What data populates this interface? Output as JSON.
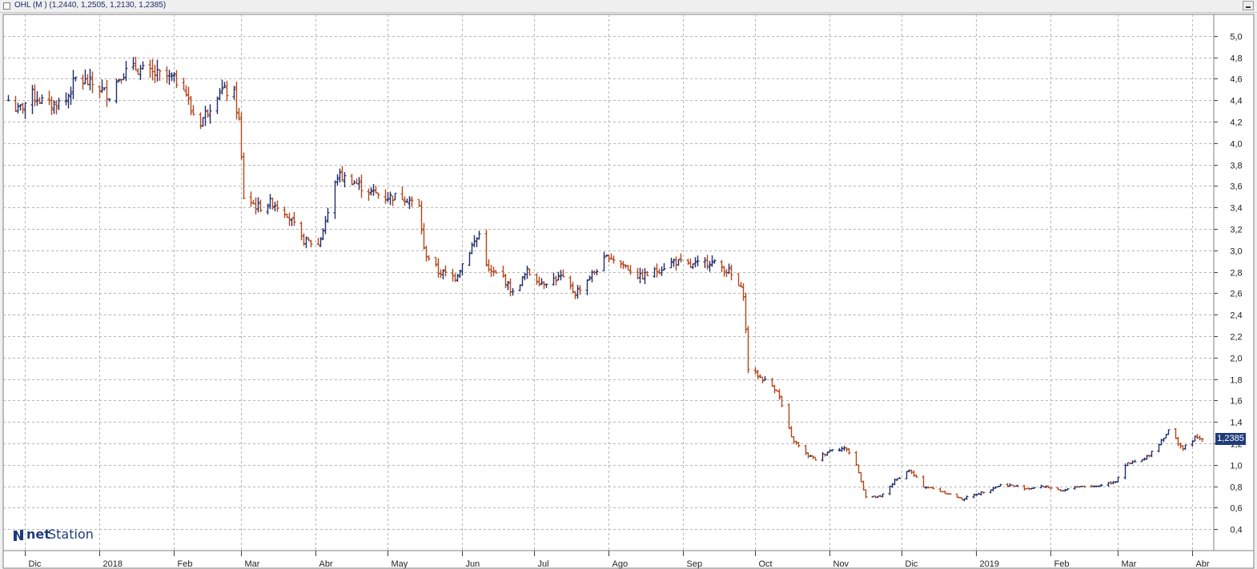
{
  "window": {
    "title": "OHL (M ) (1,2440, 1,2505, 1,2130, 1,2385)"
  },
  "logo": {
    "net": "net",
    "station": "Station"
  },
  "last_price_label": "1,2385",
  "colors": {
    "up": "#1f2d6b",
    "down": "#b4461a",
    "grid": "#b5b5b5",
    "last_tag": "#1f3b7a"
  },
  "chart_data": {
    "type": "ohlc",
    "title": "OHL (M ) (1,2440, 1,2505, 1,2130, 1,2385)",
    "last": {
      "open": 1.244,
      "high": 1.2505,
      "low": 1.213,
      "close": 1.2385
    },
    "ylim": [
      0.2,
      5.2
    ],
    "y_ticks": [
      0.4,
      0.6,
      0.8,
      1.0,
      1.2,
      1.4,
      1.6,
      1.8,
      2.0,
      2.2,
      2.4,
      2.6,
      2.8,
      3.0,
      3.2,
      3.4,
      3.6,
      3.8,
      4.0,
      4.2,
      4.4,
      4.6,
      4.8,
      5.0
    ],
    "y_tick_labels": [
      "0,4",
      "0,6",
      "0,8",
      "1,0",
      "1,2",
      "1,4",
      "1,6",
      "1,8",
      "2,0",
      "2,2",
      "2,4",
      "2,6",
      "2,8",
      "3,0",
      "3,2",
      "3,4",
      "3,6",
      "3,8",
      "4,0",
      "4,2",
      "4,4",
      "4,6",
      "4,8",
      "5,0"
    ],
    "x_months": [
      {
        "label": "Dic",
        "at": "2017-12-01"
      },
      {
        "label": "2018",
        "at": "2018-01-01"
      },
      {
        "label": "Feb",
        "at": "2018-02-01"
      },
      {
        "label": "Mar",
        "at": "2018-03-01"
      },
      {
        "label": "Abr",
        "at": "2018-04-01"
      },
      {
        "label": "May",
        "at": "2018-05-01"
      },
      {
        "label": "Jun",
        "at": "2018-06-01"
      },
      {
        "label": "Jul",
        "at": "2018-07-01"
      },
      {
        "label": "Ago",
        "at": "2018-08-01"
      },
      {
        "label": "Sep",
        "at": "2018-09-01"
      },
      {
        "label": "Oct",
        "at": "2018-10-01"
      },
      {
        "label": "Nov",
        "at": "2018-11-01"
      },
      {
        "label": "Dic",
        "at": "2018-12-01"
      },
      {
        "label": "2019",
        "at": "2019-01-01"
      },
      {
        "label": "Feb",
        "at": "2019-02-01"
      },
      {
        "label": "Mar",
        "at": "2019-03-01"
      },
      {
        "label": "Abr",
        "at": "2019-04-01"
      }
    ],
    "close_path": [
      [
        "2017-11-24",
        4.4
      ],
      [
        "2017-11-28",
        4.3
      ],
      [
        "2017-12-04",
        4.45
      ],
      [
        "2017-12-11",
        4.35
      ],
      [
        "2017-12-18",
        4.4
      ],
      [
        "2017-12-22",
        4.6
      ],
      [
        "2017-12-29",
        4.55
      ],
      [
        "2018-01-05",
        4.45
      ],
      [
        "2018-01-10",
        4.65
      ],
      [
        "2018-01-16",
        4.7
      ],
      [
        "2018-01-22",
        4.65
      ],
      [
        "2018-01-29",
        4.62
      ],
      [
        "2018-02-05",
        4.55
      ],
      [
        "2018-02-08",
        4.3
      ],
      [
        "2018-02-12",
        4.2
      ],
      [
        "2018-02-16",
        4.35
      ],
      [
        "2018-02-20",
        4.5
      ],
      [
        "2018-02-26",
        4.45
      ],
      [
        "2018-02-28",
        4.2
      ],
      [
        "2018-03-02",
        3.5
      ],
      [
        "2018-03-08",
        3.4
      ],
      [
        "2018-03-14",
        3.45
      ],
      [
        "2018-03-20",
        3.35
      ],
      [
        "2018-03-26",
        3.1
      ],
      [
        "2018-04-02",
        3.05
      ],
      [
        "2018-04-06",
        3.35
      ],
      [
        "2018-04-10",
        3.7
      ],
      [
        "2018-04-16",
        3.65
      ],
      [
        "2018-04-23",
        3.55
      ],
      [
        "2018-04-30",
        3.5
      ],
      [
        "2018-05-08",
        3.5
      ],
      [
        "2018-05-14",
        3.4
      ],
      [
        "2018-05-16",
        3.0
      ],
      [
        "2018-05-22",
        2.8
      ],
      [
        "2018-05-29",
        2.75
      ],
      [
        "2018-06-04",
        3.0
      ],
      [
        "2018-06-08",
        3.15
      ],
      [
        "2018-06-12",
        2.8
      ],
      [
        "2018-06-18",
        2.75
      ],
      [
        "2018-06-22",
        2.6
      ],
      [
        "2018-06-28",
        2.8
      ],
      [
        "2018-07-04",
        2.7
      ],
      [
        "2018-07-12",
        2.75
      ],
      [
        "2018-07-18",
        2.6
      ],
      [
        "2018-07-26",
        2.8
      ],
      [
        "2018-08-01",
        2.95
      ],
      [
        "2018-08-08",
        2.85
      ],
      [
        "2018-08-14",
        2.75
      ],
      [
        "2018-08-20",
        2.8
      ],
      [
        "2018-08-28",
        2.9
      ],
      [
        "2018-09-04",
        2.85
      ],
      [
        "2018-09-12",
        2.9
      ],
      [
        "2018-09-20",
        2.8
      ],
      [
        "2018-09-26",
        2.6
      ],
      [
        "2018-09-28",
        1.9
      ],
      [
        "2018-10-04",
        1.8
      ],
      [
        "2018-10-10",
        1.7
      ],
      [
        "2018-10-16",
        1.25
      ],
      [
        "2018-10-22",
        1.1
      ],
      [
        "2018-10-26",
        1.05
      ],
      [
        "2018-11-02",
        1.15
      ],
      [
        "2018-11-08",
        1.15
      ],
      [
        "2018-11-12",
        1.0
      ],
      [
        "2018-11-16",
        0.7
      ],
      [
        "2018-11-22",
        0.7
      ],
      [
        "2018-11-28",
        0.85
      ],
      [
        "2018-12-04",
        0.95
      ],
      [
        "2018-12-10",
        0.8
      ],
      [
        "2018-12-18",
        0.75
      ],
      [
        "2018-12-26",
        0.68
      ],
      [
        "2019-01-04",
        0.75
      ],
      [
        "2019-01-12",
        0.82
      ],
      [
        "2019-01-22",
        0.78
      ],
      [
        "2019-01-30",
        0.8
      ],
      [
        "2019-02-05",
        0.75
      ],
      [
        "2019-02-12",
        0.8
      ],
      [
        "2019-02-20",
        0.8
      ],
      [
        "2019-02-28",
        0.85
      ],
      [
        "2019-03-04",
        1.0
      ],
      [
        "2019-03-12",
        1.05
      ],
      [
        "2019-03-18",
        1.2
      ],
      [
        "2019-03-22",
        1.32
      ],
      [
        "2019-03-28",
        1.15
      ],
      [
        "2019-04-02",
        1.25
      ],
      [
        "2019-04-05",
        1.24
      ]
    ]
  }
}
